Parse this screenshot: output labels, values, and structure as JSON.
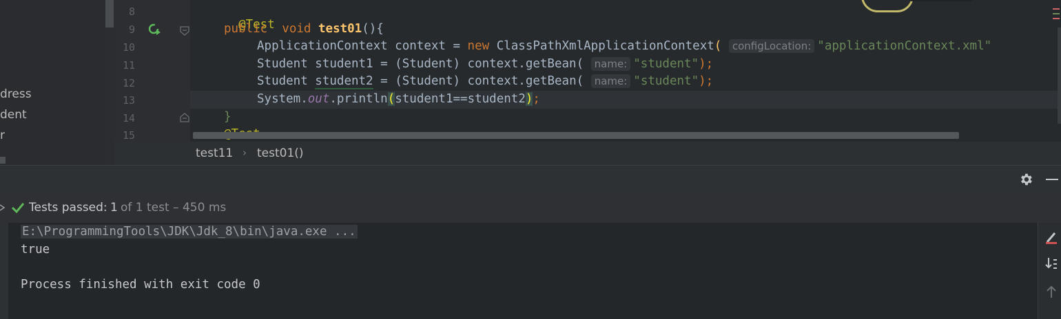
{
  "project_tree": {
    "items": [
      "dress",
      "dent",
      "r"
    ]
  },
  "editor": {
    "lines": [
      {
        "number": "8"
      },
      {
        "number": "9"
      },
      {
        "number": "10"
      },
      {
        "number": "11"
      },
      {
        "number": "12"
      },
      {
        "number": "13"
      },
      {
        "number": "14"
      },
      {
        "number": "15"
      }
    ],
    "code": {
      "l8": "@Test",
      "l9_kw1": "public",
      "l9_kw2": "void",
      "l9_fn": "test01",
      "l9_tail": "(){",
      "l10_a": "ApplicationContext context = ",
      "l10_new": "new",
      "l10_b": " ClassPathXmlApplicationContext",
      "l10_paren": "(",
      "l10_hint": "configLocation:",
      "l10_str": "\"applicationContext.xml\"",
      "l11_a": "Student student1 = (Student) context.getBean(",
      "l11_hint": "name:",
      "l11_str": "\"student\"",
      "l11_b": ");",
      "l12_a": "Student ",
      "l12_var": "student2",
      "l12_b": " = (Student) context.getBean(",
      "l12_hint": "name:",
      "l12_str": "\"student\"",
      "l12_c": ");",
      "l13_a": "System.",
      "l13_out": "out",
      "l13_b": ".println",
      "l13_open": "(",
      "l13_args": "student1==student2",
      "l13_close": ")",
      "l13_semi": ";",
      "l14": "}",
      "l15": "@Test"
    },
    "gutter_icons": [
      "run-test-icon",
      "fold-icon"
    ]
  },
  "breadcrumb": {
    "items": [
      "test11",
      "test01()"
    ],
    "separator": "›"
  },
  "run_panel": {
    "status": {
      "label": "Tests passed:",
      "count": "1",
      "detail": "of 1 test – 450 ms"
    },
    "console": {
      "command": "E:\\ProgrammingTools\\JDK\\Jdk_8\\bin\\java.exe ...",
      "output": "true",
      "finish": "Process finished with exit code 0"
    }
  },
  "colors": {
    "pass_green": "#5fb85a",
    "keyword": "#cc7832",
    "annotation": "#bbb529",
    "string": "#6a8759",
    "function": "#ffc66d"
  }
}
